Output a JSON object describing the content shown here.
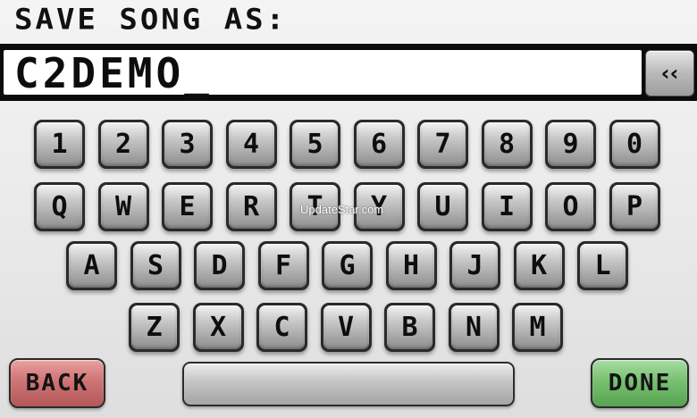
{
  "header": {
    "title": "SAVE SONG AS:"
  },
  "entry": {
    "value": "C2DEMO_"
  },
  "backspace": {
    "label": "‹‹",
    "icon": "backspace-chevrons-icon"
  },
  "keyboard": {
    "rows": [
      [
        "1",
        "2",
        "3",
        "4",
        "5",
        "6",
        "7",
        "8",
        "9",
        "0"
      ],
      [
        "Q",
        "W",
        "E",
        "R",
        "T",
        "Y",
        "U",
        "I",
        "O",
        "P"
      ],
      [
        "A",
        "S",
        "D",
        "F",
        "G",
        "H",
        "J",
        "K",
        "L"
      ],
      [
        "Z",
        "X",
        "C",
        "V",
        "B",
        "N",
        "M"
      ]
    ]
  },
  "buttons": {
    "back": "BACK",
    "done": "DONE"
  },
  "watermark": {
    "text": "UpdateStar.com"
  },
  "colors": {
    "back": "#cf7474",
    "done": "#78c070",
    "key": "#b8b8b8",
    "bar": "#0b0b0b"
  }
}
